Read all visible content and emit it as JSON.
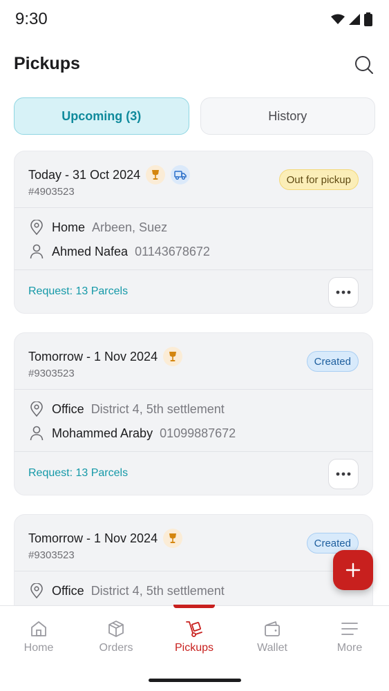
{
  "status_bar": {
    "time": "9:30"
  },
  "header": {
    "title": "Pickups"
  },
  "tabs": [
    {
      "label": "Upcoming (3)",
      "active": true
    },
    {
      "label": "History",
      "active": false
    }
  ],
  "cards": [
    {
      "date": "Today - 31 Oct 2024",
      "id": "#4903523",
      "status": "Out for pickup",
      "location_type": "Home",
      "address": "Arbeen, Suez",
      "contact_name": "Ahmed Nafea",
      "phone": "01143678672",
      "request": "Request: 13 Parcels"
    },
    {
      "date": "Tomorrow - 1 Nov 2024",
      "id": "#9303523",
      "status": "Created",
      "location_type": "Office",
      "address": "District 4, 5th settlement",
      "contact_name": "Mohammed Araby",
      "phone": "01099887672",
      "request": "Request: 13 Parcels"
    },
    {
      "date": "Tomorrow - 1 Nov 2024",
      "id": "#9303523",
      "status": "Created",
      "location_type": "Office",
      "address": "District 4, 5th settlement"
    }
  ],
  "nav": [
    {
      "label": "Home",
      "icon": "home-icon"
    },
    {
      "label": "Orders",
      "icon": "box-icon"
    },
    {
      "label": "Pickups",
      "icon": "hand-truck-icon",
      "active": true
    },
    {
      "label": "Wallet",
      "icon": "wallet-icon"
    },
    {
      "label": "More",
      "icon": "menu-icon"
    }
  ],
  "colors": {
    "accent": "#c8201e",
    "teal": "#1599a8"
  }
}
